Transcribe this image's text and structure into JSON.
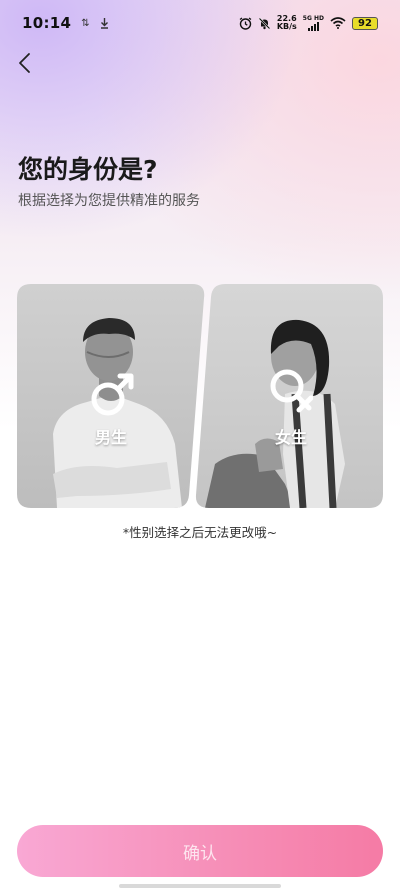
{
  "status_bar": {
    "time": "10:14",
    "speed_value": "22.6",
    "speed_unit": "KB/s",
    "network_label": "5G HD",
    "battery": "92"
  },
  "header": {
    "title": "您的身份是?",
    "subtitle": "根据选择为您提供精准的服务"
  },
  "options": {
    "male_label": "男生",
    "female_label": "女生"
  },
  "note": "*性别选择之后无法更改哦~",
  "confirm_label": "确认",
  "colors": {
    "accent_start": "#f9a8d4",
    "accent_end": "#f57ba5",
    "battery": "#e8dc2a"
  }
}
